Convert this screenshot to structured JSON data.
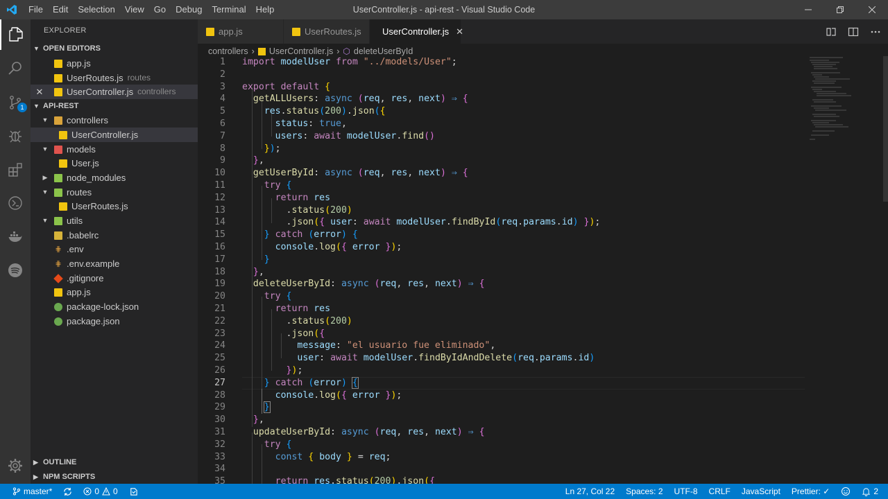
{
  "window": {
    "title": "UserController.js - api-rest - Visual Studio Code",
    "menu": [
      "File",
      "Edit",
      "Selection",
      "View",
      "Go",
      "Debug",
      "Terminal",
      "Help"
    ]
  },
  "activitybar": {
    "scm_badge": "1"
  },
  "sidebar": {
    "title": "EXPLORER",
    "open_editors_header": "OPEN EDITORS",
    "open_editors": [
      {
        "name": "app.js",
        "desc": ""
      },
      {
        "name": "UserRoutes.js",
        "desc": "routes"
      },
      {
        "name": "UserController.js",
        "desc": "controllers"
      }
    ],
    "project_header": "API-REST",
    "tree": [
      {
        "name": "controllers",
        "type": "folder"
      },
      {
        "name": "UserController.js",
        "type": "file"
      },
      {
        "name": "models",
        "type": "folder"
      },
      {
        "name": "User.js",
        "type": "file"
      },
      {
        "name": "node_modules",
        "type": "folder"
      },
      {
        "name": "routes",
        "type": "folder"
      },
      {
        "name": "UserRoutes.js",
        "type": "file"
      },
      {
        "name": "utils",
        "type": "folder"
      },
      {
        "name": ".babelrc",
        "type": "file"
      },
      {
        "name": ".env",
        "type": "file"
      },
      {
        "name": ".env.example",
        "type": "file"
      },
      {
        "name": ".gitignore",
        "type": "file"
      },
      {
        "name": "app.js",
        "type": "file"
      },
      {
        "name": "package-lock.json",
        "type": "file"
      },
      {
        "name": "package.json",
        "type": "file"
      }
    ],
    "outline_header": "OUTLINE",
    "npm_header": "NPM SCRIPTS"
  },
  "tabs": [
    {
      "label": "app.js"
    },
    {
      "label": "UserRoutes.js"
    },
    {
      "label": "UserController.js"
    }
  ],
  "breadcrumb": [
    "controllers",
    "UserController.js",
    "deleteUserById"
  ],
  "editor": {
    "line_numbers": [
      "1",
      "2",
      "3",
      "4",
      "5",
      "6",
      "7",
      "8",
      "9",
      "10",
      "11",
      "12",
      "13",
      "14",
      "15",
      "16",
      "17",
      "18",
      "19",
      "20",
      "21",
      "22",
      "23",
      "24",
      "25",
      "26",
      "27",
      "28",
      "29",
      "30",
      "31",
      "32",
      "33",
      "34",
      "35"
    ],
    "current_line": 27
  },
  "statusbar": {
    "branch": "master*",
    "errors": "0",
    "warnings": "0",
    "position": "Ln 27, Col 22",
    "spaces": "Spaces: 2",
    "encoding": "UTF-8",
    "eol": "CRLF",
    "language": "JavaScript",
    "prettier": "Prettier: ✓",
    "notifications": "2"
  },
  "colors": {
    "statusbar": "#007acc",
    "titlebar": "#3c3c3c",
    "activitybar": "#333333",
    "sidebar": "#252526",
    "editor": "#1e1e1e"
  }
}
